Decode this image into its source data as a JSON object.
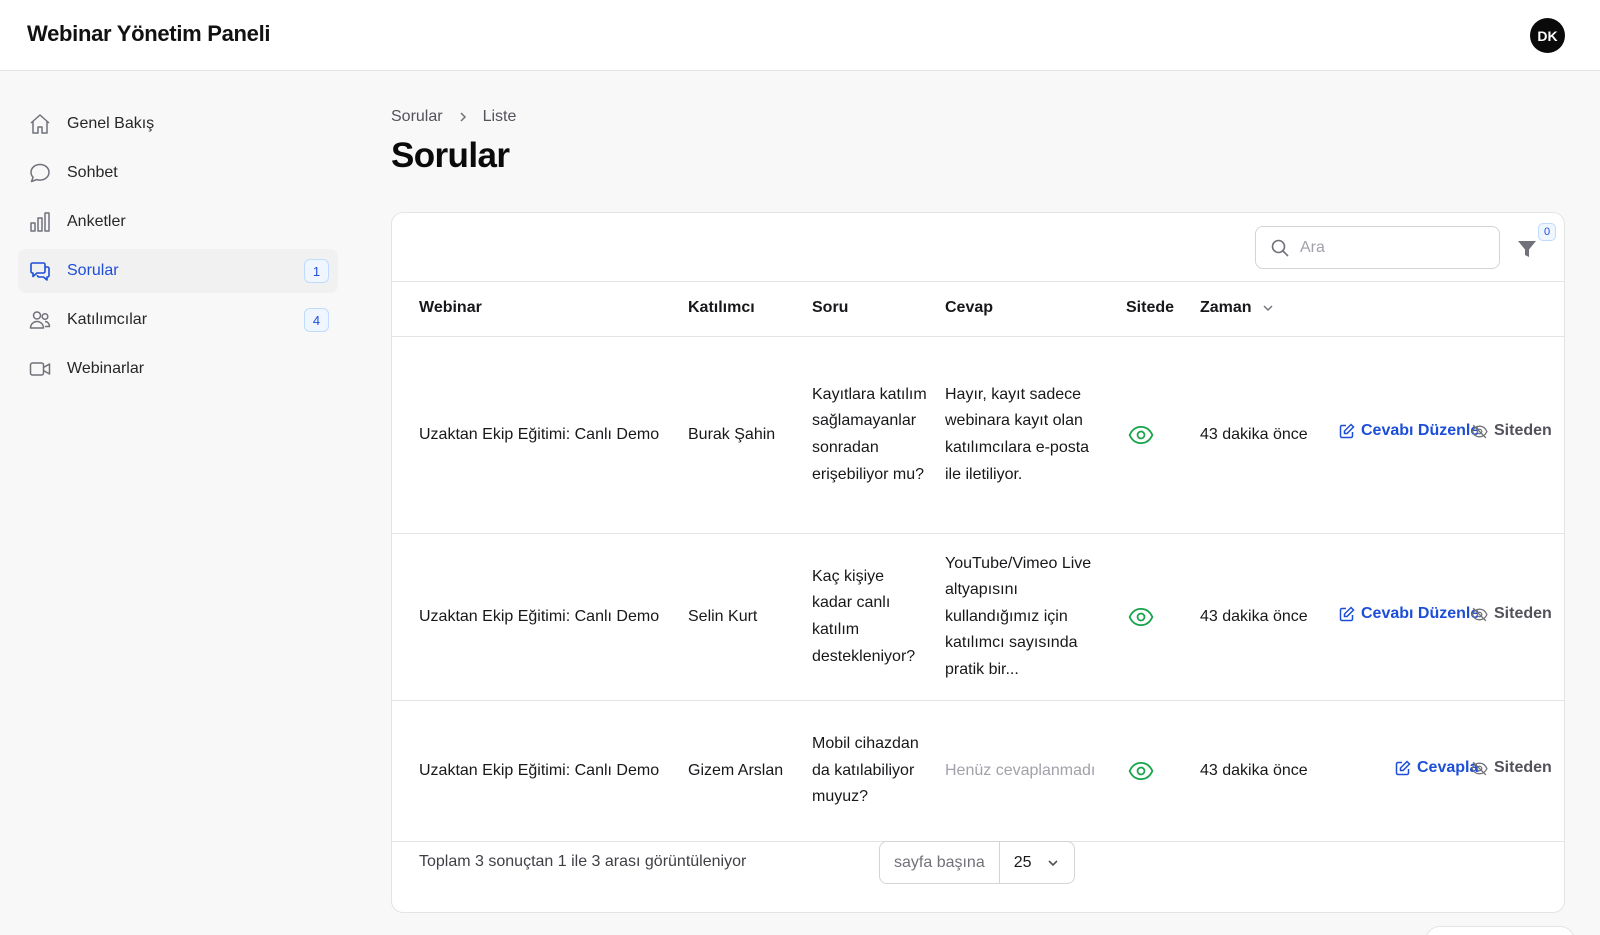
{
  "app": {
    "title": "Webinar Yönetim Paneli",
    "user_initials": "DK"
  },
  "sidebar": {
    "items": [
      {
        "label": "Genel Bakış",
        "icon": "home-icon",
        "badge": null,
        "active": false
      },
      {
        "label": "Sohbet",
        "icon": "chat-bubble-icon",
        "badge": null,
        "active": false
      },
      {
        "label": "Anketler",
        "icon": "bar-chart-icon",
        "badge": null,
        "active": false
      },
      {
        "label": "Sorular",
        "icon": "chat-bubbles-icon",
        "badge": "1",
        "active": true
      },
      {
        "label": "Katılımcılar",
        "icon": "users-icon",
        "badge": "4",
        "active": false
      },
      {
        "label": "Webinarlar",
        "icon": "video-camera-icon",
        "badge": null,
        "active": false
      }
    ]
  },
  "breadcrumb": {
    "parent": "Sorular",
    "current": "Liste"
  },
  "page": {
    "title": "Sorular"
  },
  "toolbar": {
    "search_placeholder": "Ara",
    "filter_count": "0"
  },
  "table": {
    "columns": {
      "webinar": "Webinar",
      "participant": "Katılımcı",
      "question": "Soru",
      "answer": "Cevap",
      "on_site": "Sitede",
      "time": "Zaman"
    },
    "rows": [
      {
        "webinar": "Uzaktan Ekip Eğitimi: Canlı Demo",
        "participant": "Burak Şahin",
        "question": "Kayıtlara katılım sağlamayanlar sonradan erişebiliyor mu?",
        "answer": "Hayır, kayıt sadece webinara kayıt olan katılımcılara e-posta ile iletiliyor.",
        "answered": true,
        "time": "43 dakika önce",
        "action_label": "Cevabı Düzenle",
        "hide_label": "Siteden"
      },
      {
        "webinar": "Uzaktan Ekip Eğitimi: Canlı Demo",
        "participant": "Selin Kurt",
        "question": "Kaç kişiye kadar canlı katılım destekleniyor?",
        "answer": "YouTube/Vimeo Live altyapısını kullandığımız için katılımcı sayısında pratik bir...",
        "answered": true,
        "time": "43 dakika önce",
        "action_label": "Cevabı Düzenle",
        "hide_label": "Siteden"
      },
      {
        "webinar": "Uzaktan Ekip Eğitimi: Canlı Demo",
        "participant": "Gizem Arslan",
        "question": "Mobil cihazdan da katılabiliyor muyuz?",
        "answer": "Henüz cevaplanmadı",
        "answered": false,
        "time": "43 dakika önce",
        "action_label": "Cevapla",
        "hide_label": "Siteden"
      }
    ]
  },
  "pagination": {
    "summary": "Toplam 3 sonuçtan 1 ile 3 arası görüntüleniyor",
    "per_page_label": "sayfa başına",
    "per_page_value": "25"
  },
  "colors": {
    "accent": "#1d4ed8",
    "eye_green": "#16a34a",
    "active_bg": "#f1f1f2"
  }
}
